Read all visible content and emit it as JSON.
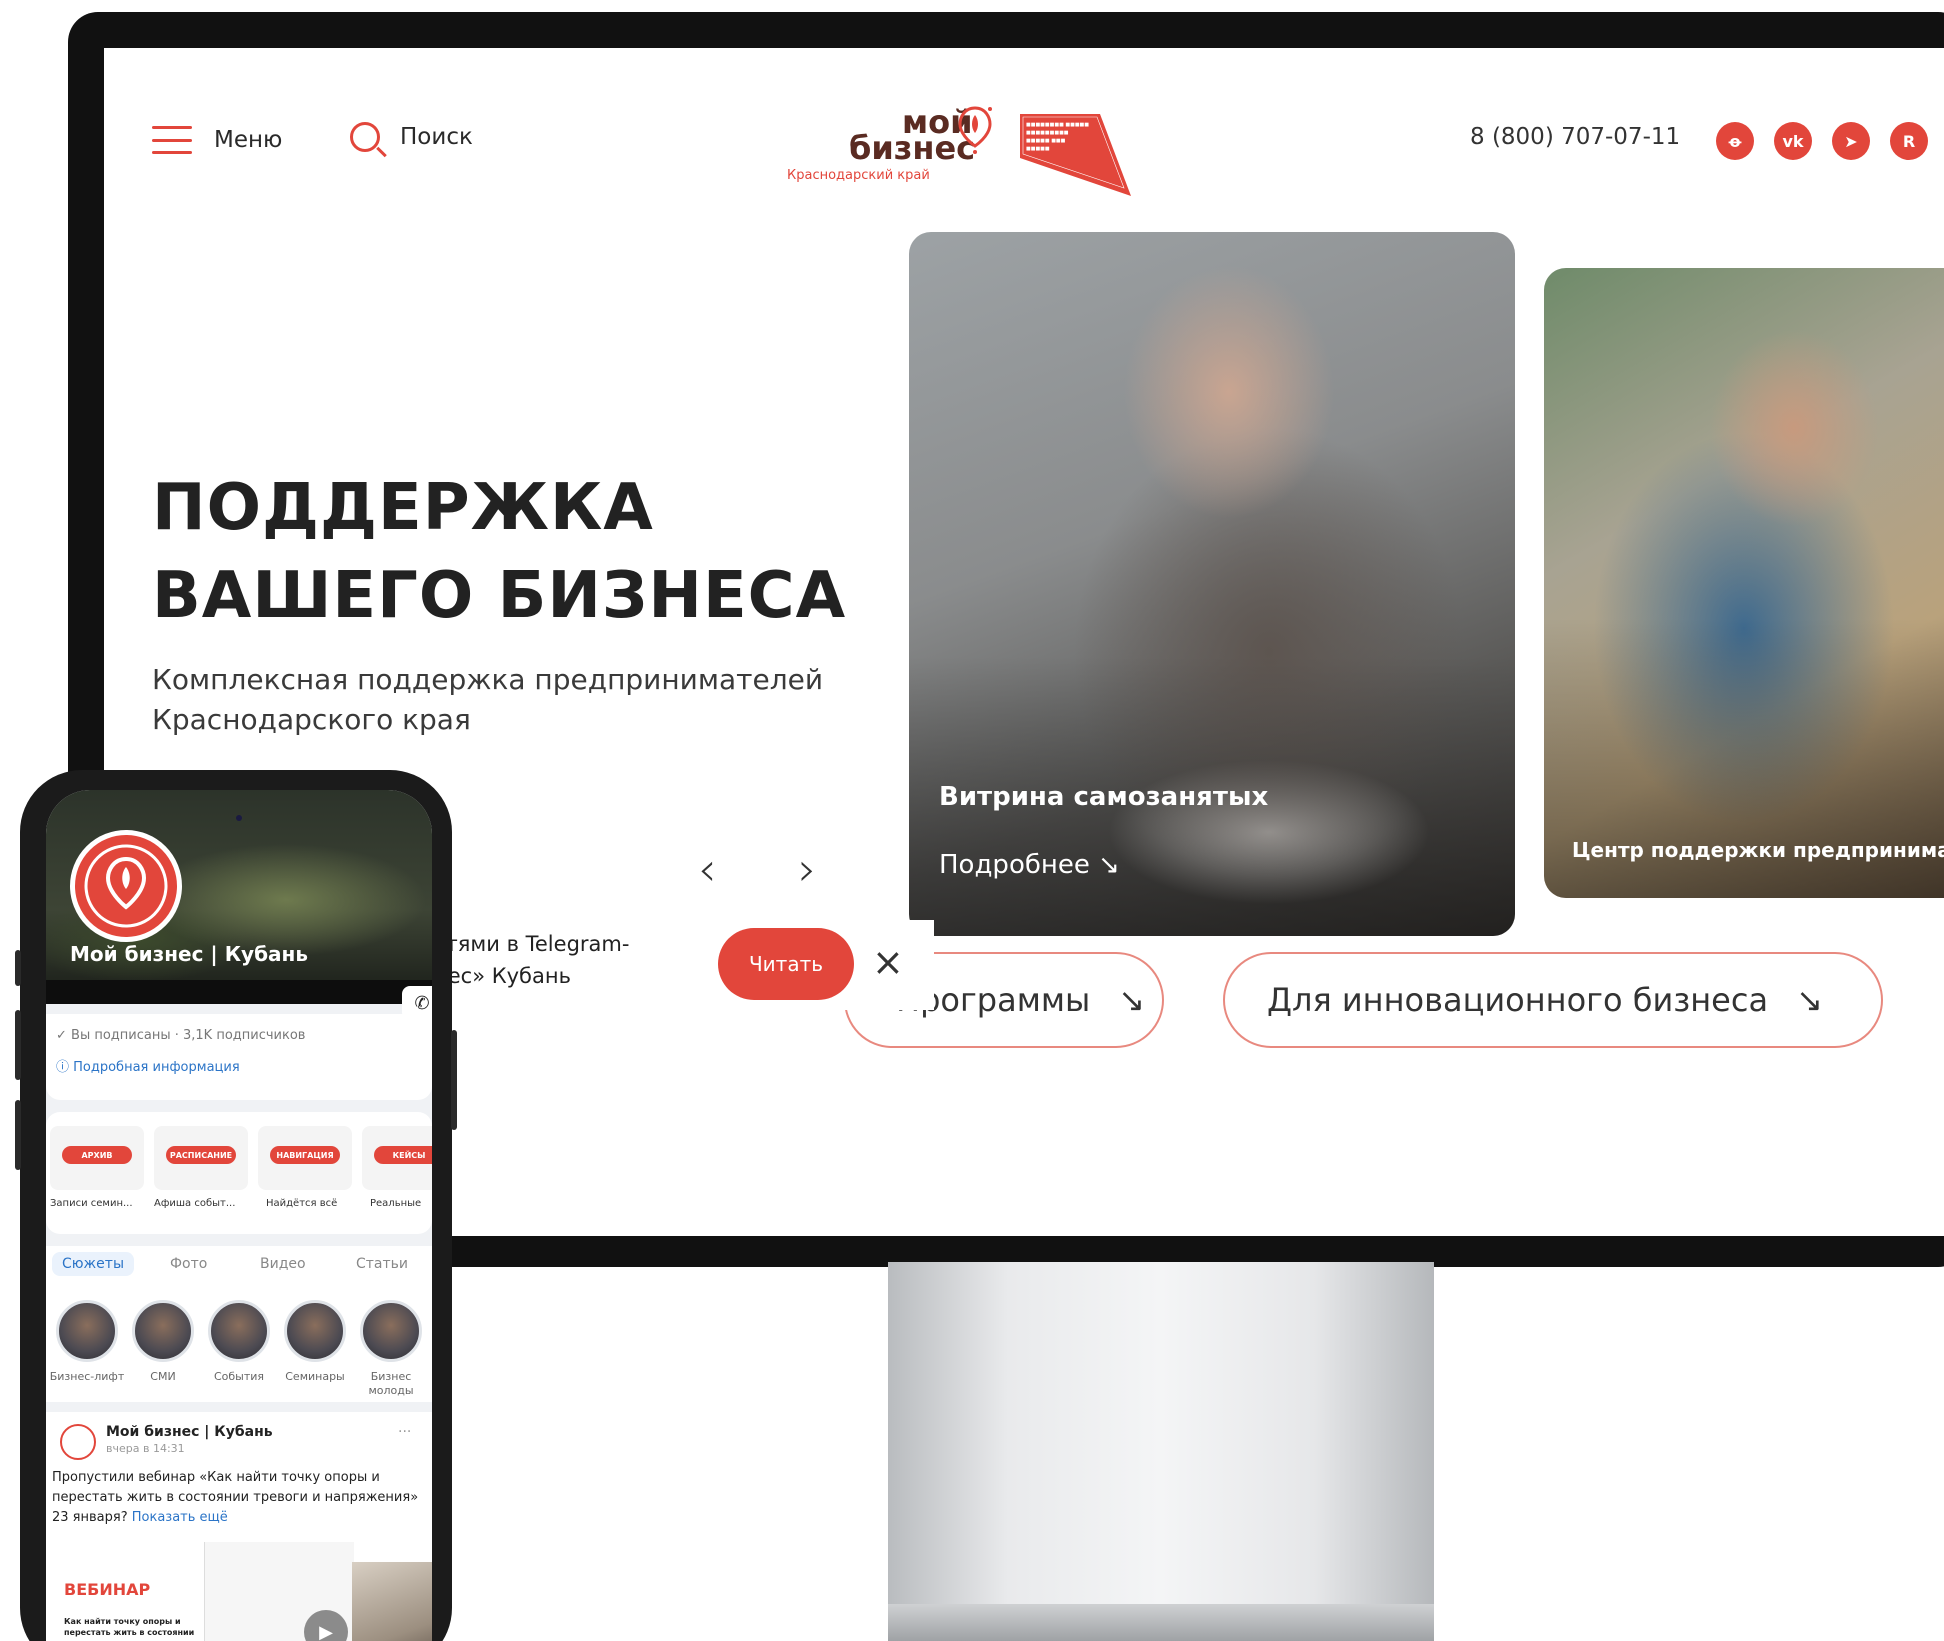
{
  "header": {
    "menu_label": "Меню",
    "search_label": "Поиск",
    "phone": "8 (800) 707-07-11",
    "socials": [
      "ok-icon",
      "vk-icon",
      "telegram-icon",
      "rutube-icon"
    ]
  },
  "logo": {
    "line1": "мой",
    "line2": "бизнес",
    "region": "Краснодарский край"
  },
  "hero": {
    "title_line1": "ПОДДЕРЖКА",
    "title_line2": "ВАШЕГО БИЗНЕСА",
    "subtitle": "Комплексная поддержка предпринимателей Краснодарского края"
  },
  "slider": {
    "prev": "‹",
    "next": "›",
    "cards": [
      {
        "title": "Витрина самозанятых",
        "more": "Подробнее ↘"
      },
      {
        "title": "Центр поддержки предпринима"
      }
    ]
  },
  "telegram_popup": {
    "text_line1": "стями в Telegram-",
    "text_line2": "нес» Кубань",
    "read_button": "Читать",
    "close": "×"
  },
  "pills": [
    {
      "label": "Программы",
      "arrow": "↘"
    },
    {
      "label": "Для инновационного бизнеса",
      "arrow": "↘"
    }
  ],
  "phone_app": {
    "group_name": "Мой бизнес | Кубань",
    "subscribed": "✓  Вы подписаны · 3,1K подписчиков",
    "more_info": "ⓘ  Подробная информация",
    "categories": [
      {
        "tag": "АРХИВ",
        "caption": "Записи семин..."
      },
      {
        "tag": "РАСПИСАНИЕ",
        "caption": "Афиша событ..."
      },
      {
        "tag": "НАВИГАЦИЯ",
        "caption": "Найдётся всё"
      },
      {
        "tag": "КЕЙСЫ",
        "caption": "Реальные"
      }
    ],
    "tabs": [
      "Сюжеты",
      "Фото",
      "Видео",
      "Статьи"
    ],
    "stories": [
      {
        "caption": "Бизнес-лифт"
      },
      {
        "caption": "СМИ"
      },
      {
        "caption": "События"
      },
      {
        "caption": "Семинары"
      },
      {
        "caption": "Бизнес молоды"
      }
    ],
    "post": {
      "author": "Мой бизнес | Кубань",
      "time": "вчера в 14:31",
      "dots": "···",
      "text": "Пропустили вебинар «Как найти точку опоры и перестать жить в состоянии тревоги и напряжения» 23 января?",
      "show_more": "Показать ещё",
      "webinar_title": "ВЕБИНАР",
      "webinar_subtitle": "Как найти точку опоры и перестать жить в состоянии тревоги и напряжения",
      "play": "▶"
    }
  },
  "colors": {
    "accent": "#e2463b",
    "link": "#2b74c7",
    "text": "#222222"
  }
}
